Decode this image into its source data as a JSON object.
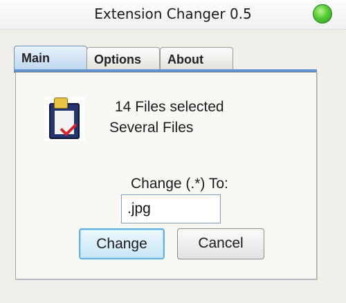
{
  "window": {
    "title": "Extension Changer 0.5"
  },
  "tabs": [
    {
      "label": "Main",
      "active": true
    },
    {
      "label": "Options",
      "active": false
    },
    {
      "label": "About",
      "active": false
    }
  ],
  "main": {
    "icon": "clipboard-check-icon",
    "file_count_text": "14 Files selected",
    "file_desc_text": "Several Files",
    "change_label": "Change (.*) To:",
    "extension_value": ".jpg",
    "change_button": "Change",
    "cancel_button": "Cancel"
  },
  "colors": {
    "accent": "#3f78bf",
    "status_light": "#53c934",
    "primary_button_border": "#64b2e2"
  }
}
